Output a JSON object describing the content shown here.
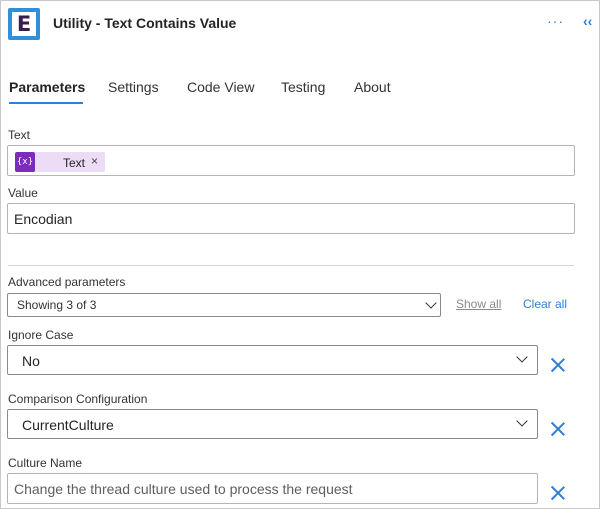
{
  "header": {
    "title": "Utility - Text Contains Value",
    "logo_letter": "E",
    "more_icon": "···",
    "collapse_icon": "‹‹"
  },
  "tabs": [
    {
      "label": "Parameters",
      "active": true
    },
    {
      "label": "Settings",
      "active": false
    },
    {
      "label": "Code View",
      "active": false
    },
    {
      "label": "Testing",
      "active": false
    },
    {
      "label": "About",
      "active": false
    }
  ],
  "fields": {
    "text": {
      "label": "Text",
      "token_icon": "{x}",
      "token_label": "Text",
      "token_remove": "×"
    },
    "value": {
      "label": "Value",
      "value": "Encodian"
    }
  },
  "advanced": {
    "label": "Advanced parameters",
    "selected": "Showing 3 of 3",
    "show_all": "Show all",
    "clear_all": "Clear all"
  },
  "params": {
    "ignore_case": {
      "label": "Ignore Case",
      "value": "No"
    },
    "comparison": {
      "label": "Comparison Configuration",
      "value": "CurrentCulture"
    },
    "culture_name": {
      "label": "Culture Name",
      "placeholder": "Change the thread culture used to process the request"
    }
  },
  "colors": {
    "accent": "#2f7ed8",
    "token_bg": "#ecdcf5",
    "token_icon": "#7b2cb8"
  }
}
